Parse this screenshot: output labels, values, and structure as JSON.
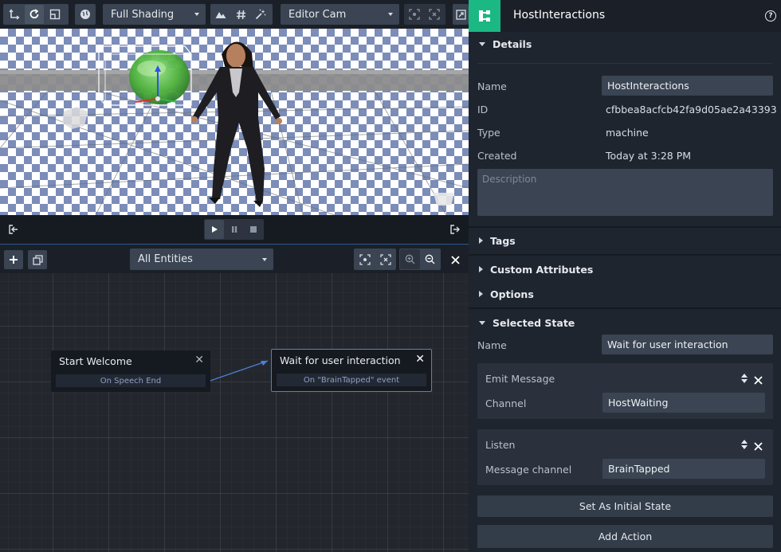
{
  "toolbar": {
    "shading_value": "Full Shading",
    "camera_value": "Editor Cam"
  },
  "playbar": {},
  "graph_toolbar": {
    "entities_value": "All Entities"
  },
  "graph": {
    "nodes": [
      {
        "title": "Start Welcome",
        "output": "On Speech End"
      },
      {
        "title": "Wait for user interaction",
        "output": "On \"BrainTapped\" event"
      }
    ]
  },
  "panel": {
    "title": "HostInteractions",
    "details": {
      "header": "Details",
      "name_label": "Name",
      "name_value": "HostInteractions",
      "id_label": "ID",
      "id_value": "cfbbea8acfcb42fa9d05ae2a43393 ...",
      "type_label": "Type",
      "type_value": "machine",
      "created_label": "Created",
      "created_value": "Today at 3:28 PM",
      "description_placeholder": "Description"
    },
    "tags_header": "Tags",
    "custom_attributes_header": "Custom Attributes",
    "options_header": "Options",
    "selected_state": {
      "header": "Selected State",
      "name_label": "Name",
      "name_value": "Wait for user interaction",
      "emit": {
        "title": "Emit Message",
        "channel_label": "Channel",
        "channel_value": "HostWaiting"
      },
      "listen": {
        "title": "Listen",
        "channel_label": "Message channel",
        "channel_value": "BrainTapped"
      },
      "set_initial_label": "Set As Initial State",
      "add_action_label": "Add Action"
    }
  }
}
